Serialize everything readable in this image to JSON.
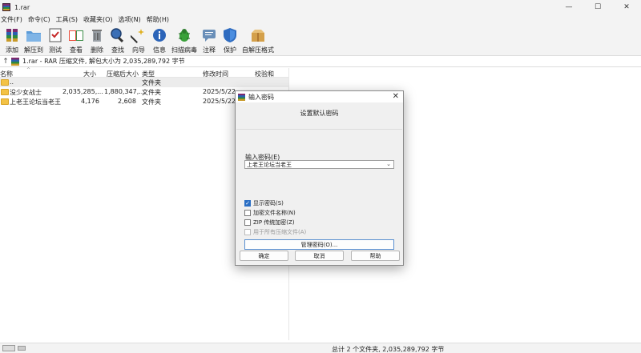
{
  "window": {
    "title": "1.rar",
    "minimize": "—",
    "maximize": "☐",
    "close": "✕"
  },
  "menu": [
    "文件(F)",
    "命令(C)",
    "工具(S)",
    "收藏夹(O)",
    "选项(N)",
    "帮助(H)"
  ],
  "toolbar": [
    {
      "label": "添加",
      "icon": "add-archive-icon"
    },
    {
      "label": "解压到",
      "icon": "extract-folder-icon"
    },
    {
      "label": "测试",
      "icon": "test-checklist-icon"
    },
    {
      "label": "查看",
      "icon": "view-book-icon"
    },
    {
      "label": "删除",
      "icon": "delete-trash-icon"
    },
    {
      "label": "查找",
      "icon": "find-magnifier-icon"
    },
    {
      "label": "向导",
      "icon": "wizard-wand-icon"
    },
    {
      "label": "信息",
      "icon": "info-icon"
    },
    {
      "label": "扫描病毒",
      "icon": "virus-scan-icon"
    },
    {
      "label": "注释",
      "icon": "comment-icon"
    },
    {
      "label": "保护",
      "icon": "protect-shield-icon"
    },
    {
      "label": "自解压格式",
      "icon": "sfx-box-icon"
    }
  ],
  "address": {
    "up": "↑",
    "text": "1.rar - RAR 压缩文件, 解包大小为 2,035,289,792 字节"
  },
  "columns": {
    "name": "名称",
    "size": "大小",
    "packed": "压缩后大小",
    "type": "类型",
    "modified": "修改时间",
    "crc": "校验和"
  },
  "files": [
    {
      "name": "..",
      "size": "",
      "packed": "",
      "type": "文件夹",
      "modified": ""
    },
    {
      "name": "没少女战士",
      "size": "2,035,285,...",
      "packed": "1,880,347,...",
      "type": "文件夹",
      "modified": "2025/5/22"
    },
    {
      "name": "上老王论坛当老王",
      "size": "4,176",
      "packed": "2,608",
      "type": "文件夹",
      "modified": "2025/5/22"
    }
  ],
  "status": {
    "text": "总计 2 个文件夹, 2,035,289,792 字节"
  },
  "dialog": {
    "title": "输入密码",
    "close": "✕",
    "heading": "设置默认密码",
    "password_label": "输入密码(E)",
    "password_value": "上老王论坛当老王",
    "options": [
      {
        "label": "显示密码(S)",
        "checked": true,
        "disabled": false
      },
      {
        "label": "加密文件名称(N)",
        "checked": false,
        "disabled": false
      },
      {
        "label": "ZIP 传统加密(Z)",
        "checked": false,
        "disabled": false
      },
      {
        "label": "用于所有压缩文件(A)",
        "checked": false,
        "disabled": true
      }
    ],
    "manage_button": "管理密码(O)...",
    "ok": "确定",
    "cancel": "取消",
    "help": "帮助"
  }
}
